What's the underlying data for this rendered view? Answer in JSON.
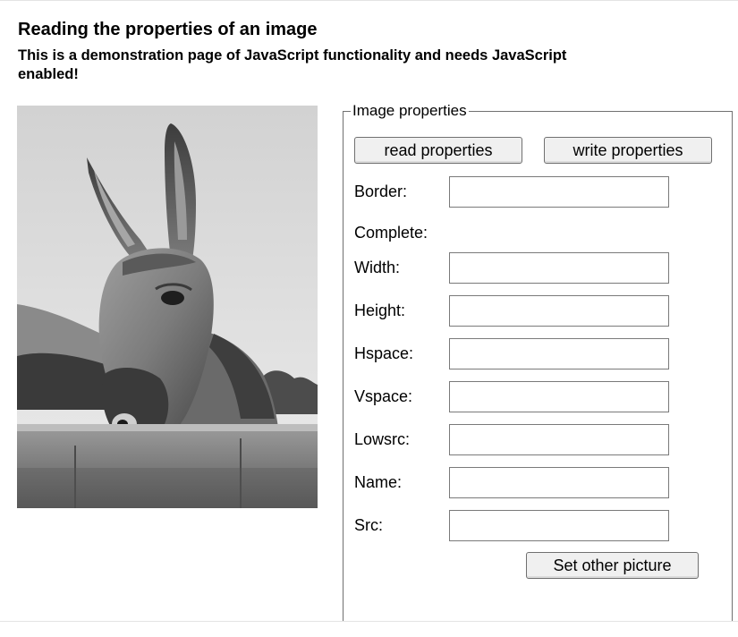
{
  "heading": "Reading the properties of an image",
  "notice": "This is a demonstration page of JavaScript functionality and needs JavaScript enabled!",
  "fieldset_legend": "Image properties",
  "buttons": {
    "read": "read properties",
    "write": "write properties",
    "other_picture": "Set other picture"
  },
  "labels": {
    "border": "Border:",
    "complete": "Complete:",
    "width": "Width:",
    "height": "Height:",
    "hspace": "Hspace:",
    "vspace": "Vspace:",
    "lowsrc": "Lowsrc:",
    "name": "Name:",
    "src": "Src:"
  },
  "values": {
    "border": "",
    "width": "",
    "height": "",
    "hspace": "",
    "vspace": "",
    "lowsrc": "",
    "name": "",
    "src": ""
  }
}
